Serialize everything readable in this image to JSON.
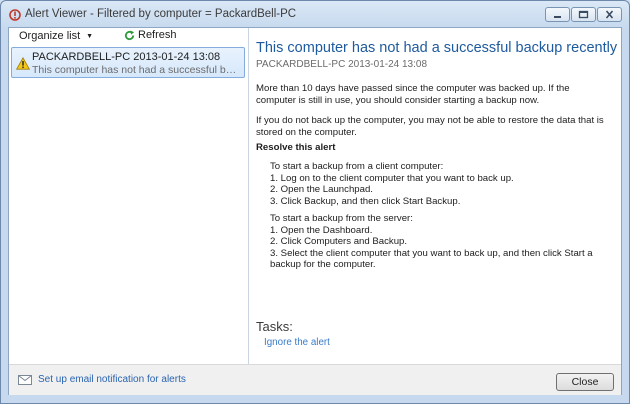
{
  "window": {
    "title": "Alert Viewer - Filtered by computer = PackardBell-PC"
  },
  "toolbar": {
    "organize_label": "Organize list",
    "organize_caret": "▼",
    "refresh_label": "Refresh"
  },
  "alerts": [
    {
      "title": "PACKARDBELL-PC 2013-01-24 13:08",
      "summary": "This computer has not had a successful backu...",
      "icon": "warning-icon"
    }
  ],
  "detail": {
    "title": "This computer has not had a successful backup recently",
    "meta": "PACKARDBELL-PC  2013-01-24 13:08",
    "paragraph1": "More than 10 days have passed since the computer was backed up. If the computer is still in use, you should consider starting a backup now.",
    "paragraph2": "If you do not back up the computer, you may not be able to restore the data that is stored on the computer.",
    "resolve_heading": "Resolve this alert",
    "client_steps": [
      "To start a backup from a client computer:",
      "1. Log on to the client computer that you want to back up.",
      "2. Open the Launchpad.",
      "3. Click Backup, and then click Start Backup."
    ],
    "server_steps": [
      "To start a backup from the server:",
      "1. Open the Dashboard.",
      "2. Click Computers and Backup.",
      "3. Select the client computer that you want to back up, and then click Start a backup for the computer."
    ],
    "tasks_heading": "Tasks:",
    "task_ignore": "Ignore the alert"
  },
  "footer": {
    "email_link": "Set up email notification for alerts",
    "close_label": "Close"
  },
  "colors": {
    "title_blue": "#1e5a9e",
    "link_blue": "#3a7bc8",
    "selection_bg": "#d6e8fb",
    "warning_yellow": "#f5c518"
  }
}
